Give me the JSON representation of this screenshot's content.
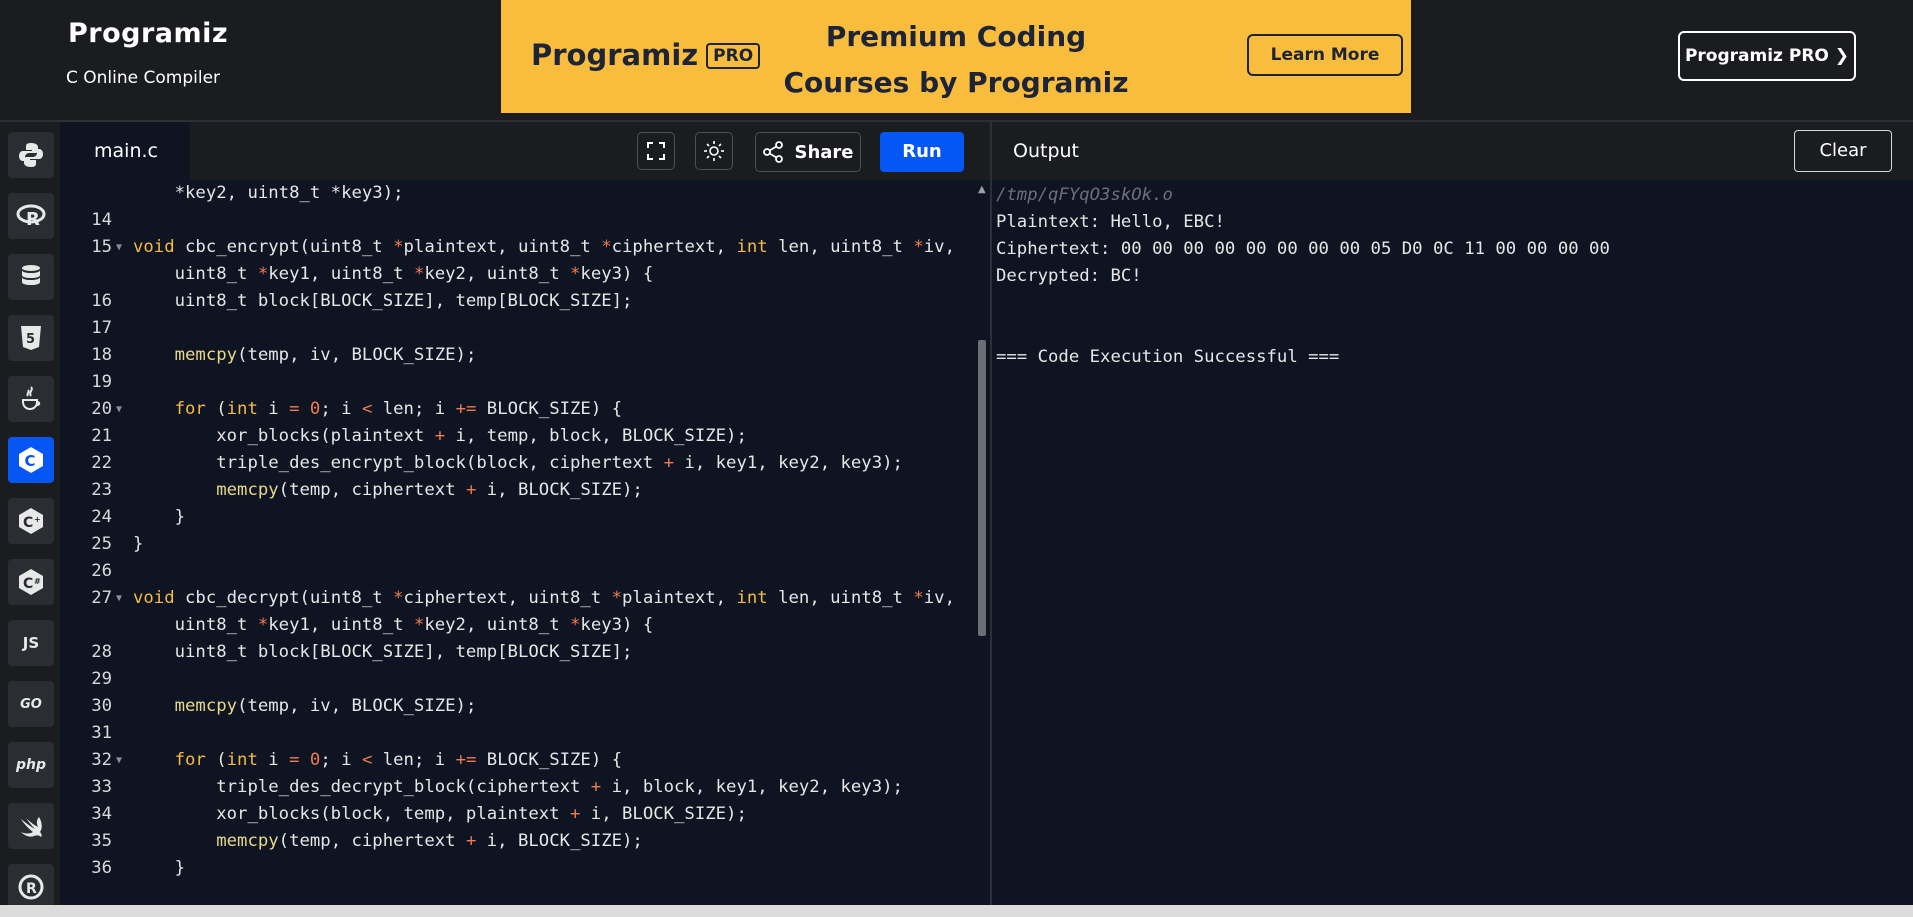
{
  "header": {
    "logo": "Programiz",
    "subtitle": "C Online Compiler",
    "banner": {
      "logo": "Programiz",
      "logo_badge": "PRO",
      "title_line1": "Premium Coding",
      "title_line2": "Courses by Programiz",
      "button": "Learn More"
    },
    "pro_button": "Programiz PRO ❯"
  },
  "sidebar": {
    "languages": [
      "python-icon",
      "r-icon",
      "sql-icon",
      "html5-icon",
      "java-icon",
      "c-icon",
      "cpp-icon",
      "csharp-icon",
      "javascript-icon",
      "go-icon",
      "php-icon",
      "swift-icon",
      "rust-icon"
    ],
    "js_label": "JS",
    "go_label": "GO",
    "php_label": "php",
    "active": "c-icon"
  },
  "editor": {
    "tab": "main.c",
    "share": "Share",
    "run": "Run"
  },
  "code": {
    "l0": "    *key2, uint8_t *key3);",
    "n14": "14",
    "n15": "15",
    "n16": "16",
    "n17": "17",
    "n18": "18",
    "n19": "19",
    "n20": "20",
    "n21": "21",
    "n22": "22",
    "n23": "23",
    "n24": "24",
    "n25": "25",
    "n26": "26",
    "n27": "27",
    "n28": "28",
    "n29": "29",
    "n30": "30",
    "n31": "31",
    "n32": "32",
    "n33": "33",
    "n34": "34",
    "n35": "35",
    "n36": "36"
  },
  "output": {
    "title": "Output",
    "clear": "Clear",
    "path": "/tmp/qFYqO3skOk.o",
    "line1": "Plaintext: Hello, EBC!",
    "line2": "Ciphertext: 00 00 00 00 00 00 00 00 05 D0 0C 11 00 00 00 00",
    "line3": "Decrypted: BC!",
    "line4": "=== Code Execution Successful ==="
  },
  "colors": {
    "run": "#0556f3",
    "banner": "#f8bd3d",
    "keyword": "#f5b945",
    "operator": "#f07c50",
    "function": "#e8d98a"
  }
}
